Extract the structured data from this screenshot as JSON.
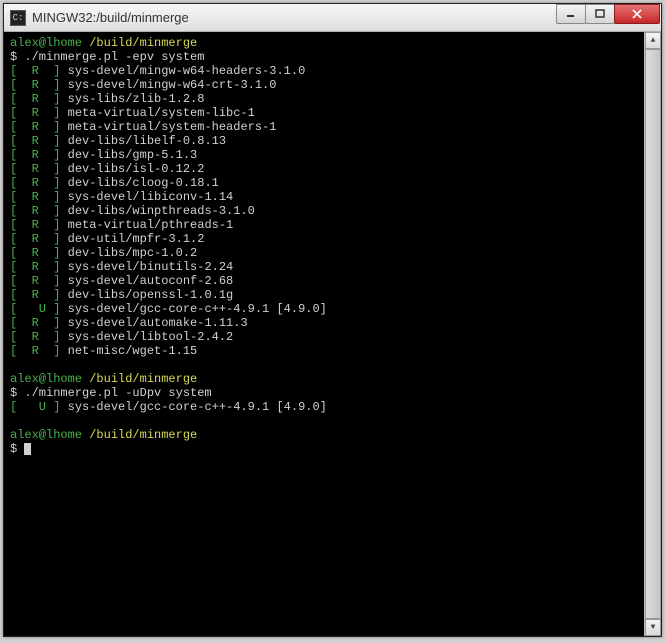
{
  "window": {
    "title": "MINGW32:/build/minmerge"
  },
  "prompt": {
    "user_host": "alex@lhome",
    "path": "/build/minmerge",
    "symbol": "$"
  },
  "session1": {
    "command": "./minmerge.pl -epv system",
    "rows": [
      {
        "flags": "[  R  ]",
        "pkg": "sys-devel/mingw-w64-headers-3.1.0"
      },
      {
        "flags": "[  R  ]",
        "pkg": "sys-devel/mingw-w64-crt-3.1.0"
      },
      {
        "flags": "[  R  ]",
        "pkg": "sys-libs/zlib-1.2.8"
      },
      {
        "flags": "[  R  ]",
        "pkg": "meta-virtual/system-libc-1"
      },
      {
        "flags": "[  R  ]",
        "pkg": "meta-virtual/system-headers-1"
      },
      {
        "flags": "[  R  ]",
        "pkg": "dev-libs/libelf-0.8.13"
      },
      {
        "flags": "[  R  ]",
        "pkg": "dev-libs/gmp-5.1.3"
      },
      {
        "flags": "[  R  ]",
        "pkg": "dev-libs/isl-0.12.2"
      },
      {
        "flags": "[  R  ]",
        "pkg": "dev-libs/cloog-0.18.1"
      },
      {
        "flags": "[  R  ]",
        "pkg": "sys-devel/libiconv-1.14"
      },
      {
        "flags": "[  R  ]",
        "pkg": "dev-libs/winpthreads-3.1.0"
      },
      {
        "flags": "[  R  ]",
        "pkg": "meta-virtual/pthreads-1"
      },
      {
        "flags": "[  R  ]",
        "pkg": "dev-util/mpfr-3.1.2"
      },
      {
        "flags": "[  R  ]",
        "pkg": "dev-libs/mpc-1.0.2"
      },
      {
        "flags": "[  R  ]",
        "pkg": "sys-devel/binutils-2.24"
      },
      {
        "flags": "[  R  ]",
        "pkg": "sys-devel/autoconf-2.68"
      },
      {
        "flags": "[  R  ]",
        "pkg": "dev-libs/openssl-1.0.1g"
      },
      {
        "flags": "[   U ]",
        "pkg": "sys-devel/gcc-core-c++-4.9.1 [4.9.0]"
      },
      {
        "flags": "[  R  ]",
        "pkg": "sys-devel/automake-1.11.3"
      },
      {
        "flags": "[  R  ]",
        "pkg": "sys-devel/libtool-2.4.2"
      },
      {
        "flags": "[  R  ]",
        "pkg": "net-misc/wget-1.15"
      }
    ]
  },
  "session2": {
    "command": "./minmerge.pl -uDpv system",
    "rows": [
      {
        "flags": "[   U ]",
        "pkg": "sys-devel/gcc-core-c++-4.9.1 [4.9.0]"
      }
    ]
  }
}
